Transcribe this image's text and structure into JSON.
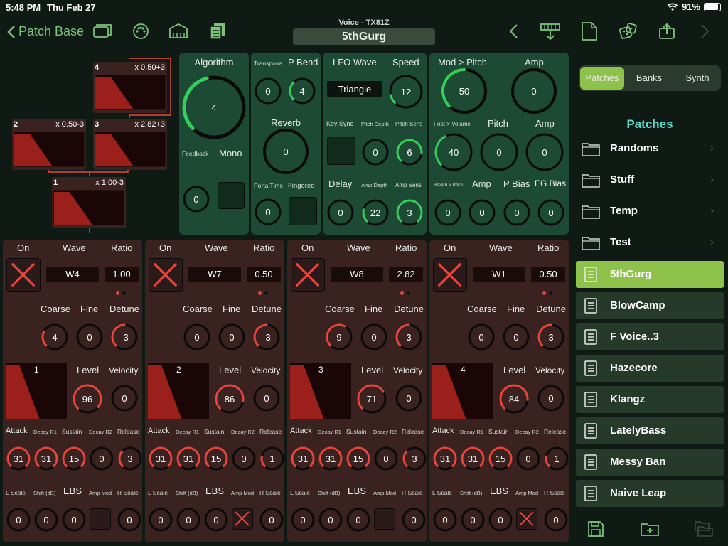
{
  "status": {
    "time": "5:48 PM",
    "date": "Thu Feb 27",
    "battery": "91%"
  },
  "toolbar": {
    "back_label": "Patch Base",
    "subtitle": "Voice - TX81Z",
    "patch_name": "5thGurg"
  },
  "algo": {
    "ops": [
      {
        "num": "4",
        "ratio": "x 0.50+3"
      },
      {
        "num": "2",
        "ratio": "x 0.50-3"
      },
      {
        "num": "3",
        "ratio": "x 2.82+3"
      },
      {
        "num": "1",
        "ratio": "x 1.00-3"
      }
    ]
  },
  "algorithm_panel": {
    "title": "Algorithm",
    "value": "4",
    "feedback_label": "Feedback",
    "mono_label": "Mono",
    "feedback_value": "0"
  },
  "pitch_panel": {
    "transpose_label": "Transpose",
    "pbend_label": "P Bend",
    "transpose": "0",
    "pbend": "4",
    "reverb_label": "Reverb",
    "reverb": "0",
    "porta_label": "Porta Time",
    "fingered_label": "Fingered",
    "porta": "0"
  },
  "lfo_panel": {
    "wave_label": "LFO Wave",
    "speed_label": "Speed",
    "wave": "Triangle",
    "speed": "12",
    "keysync_label": "Key Sync",
    "pdepth_label": "Pitch Depth",
    "psens_label": "Pitch Sens",
    "pdepth": "0",
    "psens": "6",
    "delay_label": "Delay",
    "adepth_label": "Amp Depth",
    "asens_label": "Amp Sens",
    "delay": "0",
    "adepth": "22",
    "asens": "3"
  },
  "mod_panel": {
    "modpitch_label": "Mod > Pitch",
    "amp_label": "Amp",
    "modpitch": "50",
    "amp": "0",
    "footvol_label": "Foot > Volume",
    "pitch_label": "Pitch",
    "amp2_label": "Amp",
    "footvol": "40",
    "pitch": "0",
    "amp2": "0",
    "breath_label": "Breath > Pitch",
    "amp3_label": "Amp",
    "pbias_label": "P Bias",
    "egbias_label": "EG Bias",
    "breath": "0",
    "amp3": "0",
    "pbias": "0",
    "egbias": "0"
  },
  "op_labels": {
    "on": "On",
    "wave": "Wave",
    "ratio": "Ratio",
    "coarse": "Coarse",
    "fine": "Fine",
    "detune": "Detune",
    "level": "Level",
    "velocity": "Velocity",
    "attack": "Attack",
    "decay1": "Decay R1",
    "sustain": "Sustain",
    "decay2": "Decay R2",
    "release": "Release",
    "lscale": "L Scale",
    "shift": "Shift (dB)",
    "ebs": "EBS",
    "ampmod": "Amp Mod",
    "rscale": "R Scale"
  },
  "operators": [
    {
      "num": "1",
      "wave": "W4",
      "ratio": "1.00",
      "coarse": "4",
      "fine": "0",
      "detune": "-3",
      "level": "96",
      "velocity": "0",
      "attack": "31",
      "decay1": "31",
      "sustain": "15",
      "decay2": "0",
      "release": "3",
      "lscale": "0",
      "shift": "0",
      "ebs": "0",
      "rscale": "0",
      "ampmod_on": false
    },
    {
      "num": "2",
      "wave": "W7",
      "ratio": "0.50",
      "coarse": "0",
      "fine": "0",
      "detune": "-3",
      "level": "86",
      "velocity": "0",
      "attack": "31",
      "decay1": "31",
      "sustain": "15",
      "decay2": "0",
      "release": "1",
      "lscale": "0",
      "shift": "0",
      "ebs": "0",
      "rscale": "0",
      "ampmod_on": true
    },
    {
      "num": "3",
      "wave": "W8",
      "ratio": "2.82",
      "coarse": "9",
      "fine": "0",
      "detune": "3",
      "level": "71",
      "velocity": "0",
      "attack": "31",
      "decay1": "31",
      "sustain": "15",
      "decay2": "0",
      "release": "3",
      "lscale": "0",
      "shift": "0",
      "ebs": "0",
      "rscale": "0",
      "ampmod_on": false
    },
    {
      "num": "4",
      "wave": "W1",
      "ratio": "0.50",
      "coarse": "0",
      "fine": "0",
      "detune": "3",
      "level": "84",
      "velocity": "0",
      "attack": "31",
      "decay1": "31",
      "sustain": "15",
      "decay2": "0",
      "release": "1",
      "lscale": "0",
      "shift": "0",
      "ebs": "0",
      "rscale": "0",
      "ampmod_on": true
    }
  ],
  "sidebar": {
    "tabs": [
      "Patches",
      "Banks",
      "Synth"
    ],
    "section_title": "Patches",
    "folders": [
      "Randoms",
      "Stuff",
      "Temp",
      "Test"
    ],
    "patches": [
      "5thGurg",
      "BlowCamp",
      "F Voice..3",
      "Hazecore",
      "Klangz",
      "LatelyBass",
      "Messy Ban",
      "Naive Leap"
    ],
    "selected": "5thGurg"
  },
  "colors": {
    "accent_green": "#33d15a",
    "accent_red": "#e8463c",
    "panel_green": "#1d4a34",
    "op_bg": "#3a2220",
    "selected": "#8fc24a"
  }
}
